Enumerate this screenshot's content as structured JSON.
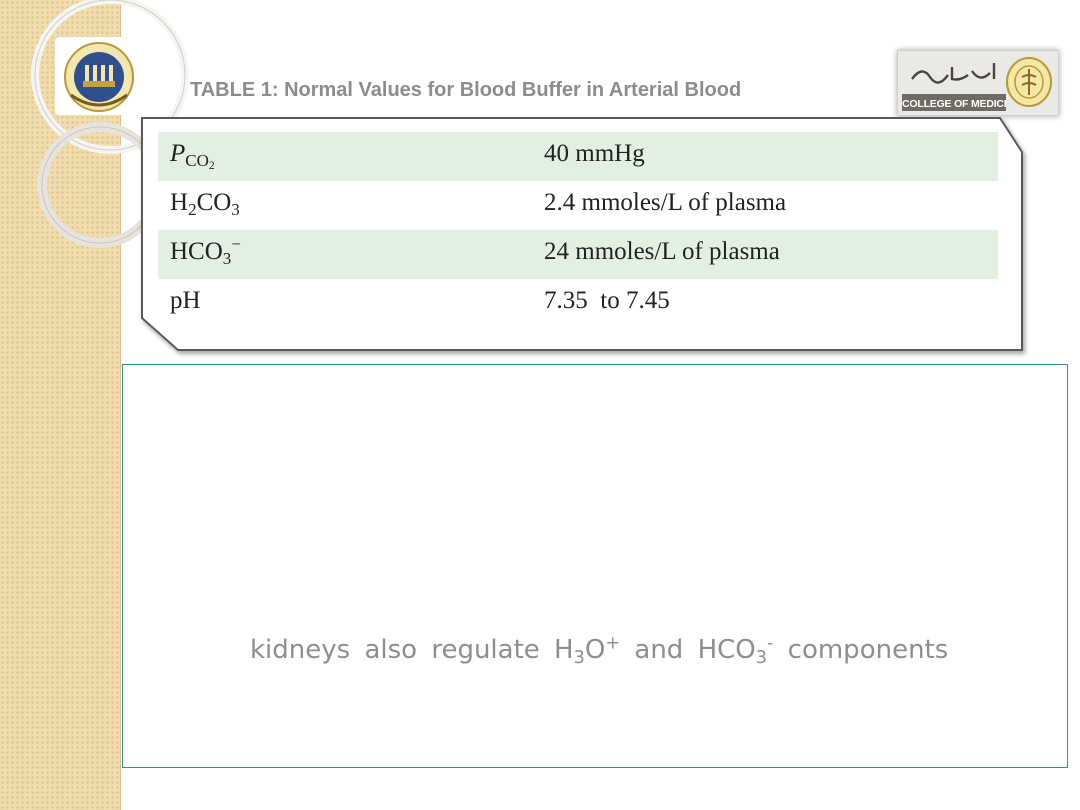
{
  "title": "TABLE 1: Normal Values for Blood Buffer in Arterial Blood",
  "logos": {
    "left": "university-seal",
    "right_caption": "COLLEGE OF MEDICINE"
  },
  "table": {
    "rows": [
      {
        "parameter": "P",
        "parameter_sub": "CO",
        "parameter_sub2": "2",
        "value": "40 mmHg"
      },
      {
        "parameter": "H",
        "parameter_sub": "2",
        "parameter_mid": "CO",
        "parameter_sub2": "3",
        "value": "2.4 mmoles/L of plasma"
      },
      {
        "parameter": "HCO",
        "parameter_sub": "3",
        "parameter_sup": "−",
        "value": "24 mmoles/L of plasma"
      },
      {
        "parameter": "pH",
        "value": "7.35  to 7.45"
      }
    ]
  },
  "sentence": {
    "part1": "kidneys also regulate H",
    "sub1": "3",
    "part2": "O",
    "sup1": "+",
    "part3": " and HCO",
    "sub2": "3",
    "sup2": "-",
    "part4": " components"
  },
  "colors": {
    "strip": "#f1dcae",
    "row_shade": "#e3efe3",
    "rule": "#1a8a4a",
    "content_border": "#3a8a8a",
    "title": "#8c8c8c"
  }
}
